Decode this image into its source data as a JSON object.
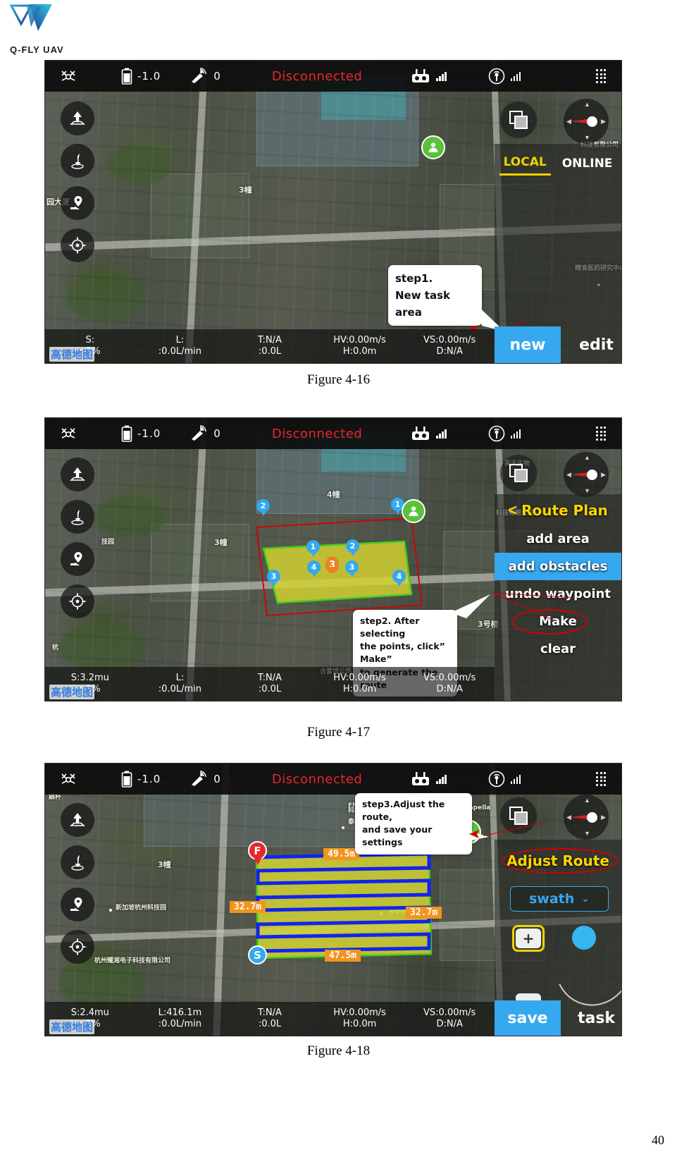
{
  "brand": {
    "name": "Q-FLY UAV",
    "logo_icon": "qfly-triangle-logo"
  },
  "page_number": "40",
  "status_bar": {
    "drone_icon": "drone-icon",
    "battery_icon": "battery-icon",
    "battery_value": "-1.0",
    "satellite_icon": "satellite-dish-icon",
    "satellite_value": "0",
    "connection_status": "Disconnected",
    "connection_color": "#e8262c",
    "rc_icon": "remote-controller-icon",
    "rc_signal_icon": "signal-bars-icon",
    "link_icon": "rc-broadcast-icon",
    "link_signal_icon": "signal-bars-icon",
    "menu_icon": "menu-dots-icon"
  },
  "left_tools": [
    {
      "name": "takeoff-button",
      "icon": "takeoff-arrow-up-icon"
    },
    {
      "name": "land-button",
      "icon": "land-arrow-down-icon"
    },
    {
      "name": "waypoint-button",
      "icon": "map-pin-icon"
    },
    {
      "name": "locate-button",
      "icon": "crosshair-target-icon"
    }
  ],
  "map_controls": {
    "layers_icon": "map-layers-icon",
    "compass_icon": "compass-needle-icon"
  },
  "map_labels": [
    {
      "text": "3幢"
    },
    {
      "text": "4幢"
    },
    {
      "text": "3号楼"
    },
    {
      "text": "园大厦"
    },
    {
      "text": "科技有限公司"
    },
    {
      "text": "英天生物"
    },
    {
      "text": "精准医药研究中心"
    },
    {
      "text": "杭州耀湘电子科技有限公司"
    },
    {
      "text": "新加坡杭州科技园"
    },
    {
      "text": "青铁供应链公司"
    },
    {
      "text": "Capella"
    },
    {
      "text": "銀杯"
    }
  ],
  "amap_watermark": "高德地图",
  "figures": [
    {
      "id": "fig-4-16",
      "caption": "Figure 4-16",
      "tabs": [
        {
          "label": "LOCAL",
          "active": true
        },
        {
          "label": "ONLINE",
          "active": false
        }
      ],
      "callout": {
        "line1": "step1.",
        "line2": "New task area"
      },
      "buttons": {
        "primary": "new",
        "secondary": "edit"
      },
      "telemetry": [
        {
          "top": "S:",
          "bottom": ":-1%"
        },
        {
          "top": "L:",
          "bottom": ":0.0L/min"
        },
        {
          "top": "T:N/A",
          "bottom": ":0.0L"
        },
        {
          "top": "HV:0.00m/s",
          "bottom": "H:0.0m"
        },
        {
          "top": "VS:0.00m/s",
          "bottom": "D:N/A"
        }
      ]
    },
    {
      "id": "fig-4-17",
      "caption": "Figure 4-17",
      "panel": {
        "back_icon": "chevron-left-icon",
        "title": "Route Plan",
        "items": [
          {
            "label": "add  area",
            "highlighted": false,
            "circled": false
          },
          {
            "label": "add obstacles",
            "highlighted": true,
            "circled": false
          },
          {
            "label": "undo waypoint",
            "highlighted": false,
            "circled": false
          },
          {
            "label": "Make",
            "highlighted": false,
            "circled": true
          },
          {
            "label": "clear",
            "highlighted": false,
            "circled": false
          }
        ]
      },
      "callout": {
        "line1": "step2. After selecting",
        "line2": "the points, click”  Make”",
        "line3": "to generate the route"
      },
      "waypoints_blue": [
        "1",
        "2",
        "3",
        "4"
      ],
      "waypoints_area": [
        "1",
        "2",
        "3",
        "4"
      ],
      "waypoint_center": "3",
      "telemetry": [
        {
          "top": "S:3.2mu",
          "bottom": ":-1%"
        },
        {
          "top": "L:",
          "bottom": ":0.0L/min"
        },
        {
          "top": "T:N/A",
          "bottom": ":0.0L"
        },
        {
          "top": "HV:0.00m/s",
          "bottom": "H:0.0m"
        },
        {
          "top": "VS:0.00m/s",
          "bottom": "D:N/A"
        }
      ]
    },
    {
      "id": "fig-4-18",
      "caption": "Figure 4-18",
      "panel": {
        "title": "Adjust Route",
        "select_value": "swath",
        "select_icon": "chevron-down-icon",
        "plus_label": "+",
        "minus_label": "−"
      },
      "callout": {
        "line1": "step3.Adjust the route,",
        "line2": "and save your settings"
      },
      "route": {
        "start_marker": "S",
        "finish_marker": "F",
        "dimension_top": "49.5m",
        "dimension_left": "32.7m",
        "dimension_right": "32.7m",
        "dimension_bottom": "47.5m"
      },
      "buttons": {
        "primary": "save",
        "secondary": "task"
      },
      "telemetry": [
        {
          "top": "S:2.4mu",
          "bottom": ":-1%"
        },
        {
          "top": "L:416.1m",
          "bottom": ":0.0L/min"
        },
        {
          "top": "T:N/A",
          "bottom": ":0.0L"
        },
        {
          "top": "HV:0.00m/s",
          "bottom": "H:0.0m"
        },
        {
          "top": "VS:0.00m/s",
          "bottom": "D:N/A"
        }
      ]
    }
  ],
  "colors": {
    "accent_blue": "#35a8f0",
    "accent_yellow": "#f2d200",
    "alert_red": "#e8262c",
    "chip_orange": "#f2941f",
    "area_fill": "#d4d431",
    "route_blue": "#1024ef"
  }
}
